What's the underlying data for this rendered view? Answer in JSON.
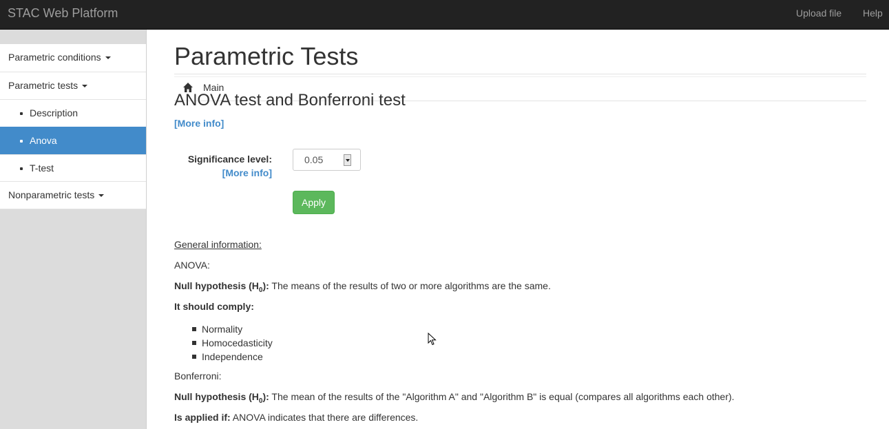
{
  "navbar": {
    "brand": "STAC Web Platform",
    "links": [
      "Upload file",
      "Help"
    ]
  },
  "sidebar": {
    "items": [
      {
        "label": "Main",
        "icon": "home-icon"
      },
      {
        "label": "Parametric conditions"
      },
      {
        "label": "Parametric tests"
      },
      {
        "label": "Description"
      },
      {
        "label": "Anova",
        "active": true
      },
      {
        "label": "T-test"
      },
      {
        "label": "Nonparametric tests"
      }
    ]
  },
  "main": {
    "title": "Parametric Tests",
    "section_title": "ANOVA test and Bonferroni test",
    "more_info": "[More info]",
    "form": {
      "significance_label": "Significance level:",
      "significance_more": "[More info]",
      "significance_value": "0.05",
      "apply_label": "Apply"
    },
    "info": {
      "heading": "General information:",
      "anova_label": "ANOVA:",
      "null_hypothesis_label": "Null hypothesis (H",
      "null_hypothesis_sub": "0",
      "null_hypothesis_close": "):",
      "anova_null_text": " The means of the results of two or more algorithms are the same.",
      "comply_label": "It should comply:",
      "conditions": [
        "Normality",
        "Homocedasticity",
        "Independence"
      ],
      "bonferroni_label": "Bonferroni:",
      "bonferroni_null_text": " The mean of the results of the \"Algorithm A\" and \"Algorithm B\" is equal (compares all algorithms each other).",
      "applied_label": "Is applied if:",
      "applied_text": " ANOVA indicates that there are differences."
    }
  },
  "colors": {
    "navbar": "#222222",
    "active": "#428bca",
    "apply": "#5cb85c",
    "link": "#428bca"
  }
}
